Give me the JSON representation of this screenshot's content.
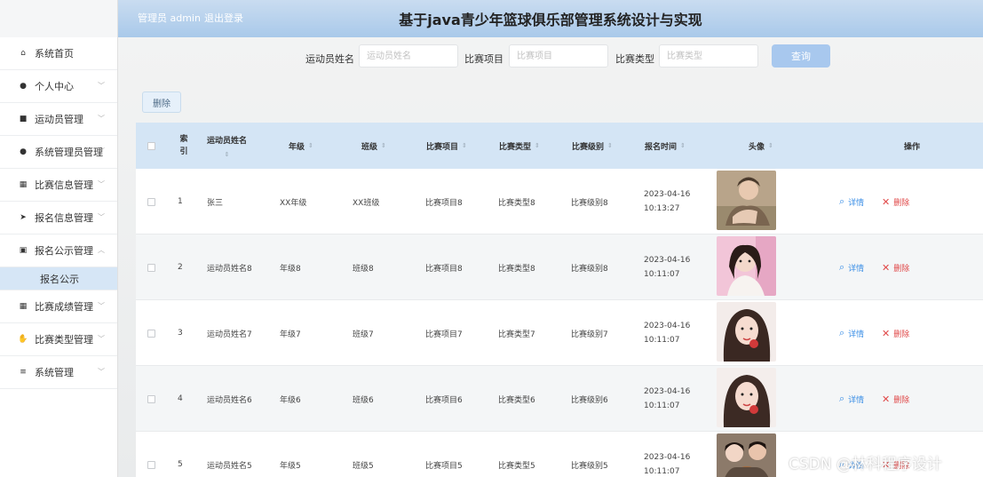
{
  "header": {
    "admin_label": "管理员 admin",
    "logout_label": "退出登录",
    "title": "基于java青少年篮球俱乐部管理系统设计与实现"
  },
  "sidebar": {
    "items": [
      {
        "label": "系统首页",
        "icon": "home-icon",
        "glyph": "⌂",
        "chevron": false
      },
      {
        "label": "个人中心",
        "icon": "user-icon",
        "glyph": "●",
        "chevron": true
      },
      {
        "label": "运动员管理",
        "icon": "briefcase-icon",
        "glyph": "■",
        "chevron": true
      },
      {
        "label": "系统管理员管理",
        "icon": "user-icon",
        "glyph": "●",
        "chevron": true
      },
      {
        "label": "比赛信息管理",
        "icon": "grid-icon",
        "glyph": "▦",
        "chevron": true
      },
      {
        "label": "报名信息管理",
        "icon": "send-icon",
        "glyph": "➤",
        "chevron": true
      },
      {
        "label": "报名公示管理",
        "icon": "clipboard-icon",
        "glyph": "▣",
        "chevron": true,
        "expanded": true
      },
      {
        "label": "比赛成绩管理",
        "icon": "grid-icon",
        "glyph": "▦",
        "chevron": true
      },
      {
        "label": "比赛类型管理",
        "icon": "thumbs-up-icon",
        "glyph": "✋",
        "chevron": true
      },
      {
        "label": "系统管理",
        "icon": "list-icon",
        "glyph": "≡",
        "chevron": true
      }
    ],
    "submenu": {
      "label": "报名公示"
    }
  },
  "search": {
    "athlete_label": "运动员姓名",
    "athlete_placeholder": "运动员姓名",
    "item_label": "比赛项目",
    "item_placeholder": "比赛项目",
    "type_label": "比赛类型",
    "type_placeholder": "比赛类型",
    "query_button": "查询"
  },
  "toolbar": {
    "delete_button": "删除"
  },
  "table": {
    "headers": {
      "index": "索引",
      "name": "运动员姓名",
      "grade": "年级",
      "class": "班级",
      "item": "比赛项目",
      "type": "比赛类型",
      "level": "比赛级别",
      "time": "报名时间",
      "avatar": "头像",
      "ops": "操作"
    },
    "detail_label": "详情",
    "delete_label": "删除",
    "rows": [
      {
        "index": "1",
        "name": "张三",
        "grade": "XX年级",
        "class": "XX班级",
        "item": "比赛项目8",
        "type": "比赛类型8",
        "level": "比赛级别8",
        "date": "2023-04-16",
        "time": "10:13:27"
      },
      {
        "index": "2",
        "name": "运动员姓名8",
        "grade": "年级8",
        "class": "班级8",
        "item": "比赛项目8",
        "type": "比赛类型8",
        "level": "比赛级别8",
        "date": "2023-04-16",
        "time": "10:11:07"
      },
      {
        "index": "3",
        "name": "运动员姓名7",
        "grade": "年级7",
        "class": "班级7",
        "item": "比赛项目7",
        "type": "比赛类型7",
        "level": "比赛级别7",
        "date": "2023-04-16",
        "time": "10:11:07"
      },
      {
        "index": "4",
        "name": "运动员姓名6",
        "grade": "年级6",
        "class": "班级6",
        "item": "比赛项目6",
        "type": "比赛类型6",
        "level": "比赛级别6",
        "date": "2023-04-16",
        "time": "10:11:07"
      },
      {
        "index": "5",
        "name": "运动员姓名5",
        "grade": "年级5",
        "class": "班级5",
        "item": "比赛项目5",
        "type": "比赛类型5",
        "level": "比赛级别5",
        "date": "2023-04-16",
        "time": "10:11:07"
      }
    ]
  },
  "watermark": "CSDN @林科程序设计"
}
